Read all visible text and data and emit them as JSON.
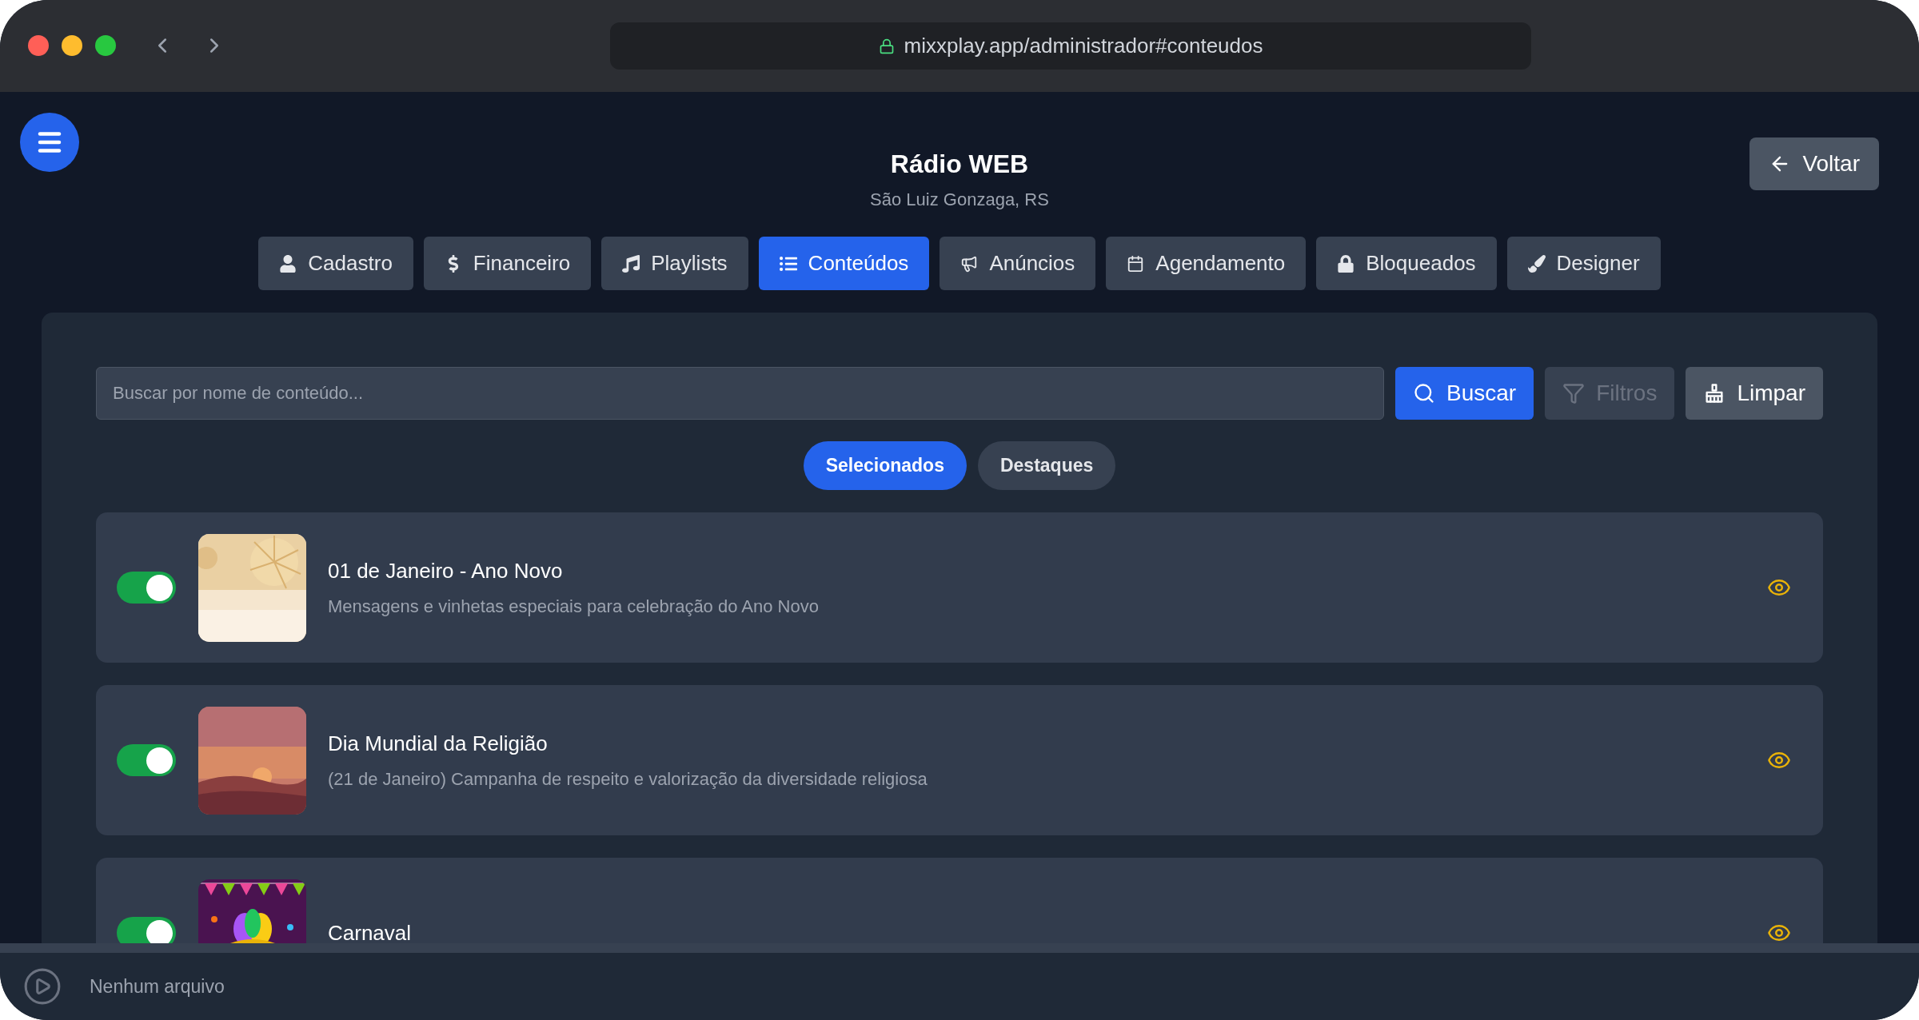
{
  "browser": {
    "url": "mixxplay.app/administrador#conteudos"
  },
  "header": {
    "title": "Rádio WEB",
    "subtitle": "São Luiz Gonzaga, RS",
    "back_button": "Voltar"
  },
  "tabs": [
    {
      "label": "Cadastro",
      "selected": false
    },
    {
      "label": "Financeiro",
      "selected": false
    },
    {
      "label": "Playlists",
      "selected": false
    },
    {
      "label": "Conteúdos",
      "selected": true
    },
    {
      "label": "Anúncios",
      "selected": false
    },
    {
      "label": "Agendamento",
      "selected": false
    },
    {
      "label": "Bloqueados",
      "selected": false
    },
    {
      "label": "Designer",
      "selected": false
    }
  ],
  "search": {
    "placeholder": "Buscar por nome de conteúdo...",
    "buttons": [
      {
        "label": "Buscar",
        "kind": "search",
        "disabled": false
      },
      {
        "label": "Filtros",
        "kind": "filter",
        "disabled": true
      },
      {
        "label": "Limpar",
        "kind": "clear",
        "disabled": false
      }
    ]
  },
  "filter_pills": [
    {
      "label": "Selecionados",
      "selected": true
    },
    {
      "label": "Destaques",
      "selected": false
    }
  ],
  "items": [
    {
      "title": "01 de Janeiro - Ano Novo",
      "description": "Mensagens e vinhetas especiais para celebração do Ano Novo",
      "on": true
    },
    {
      "title": "Dia Mundial da Religião",
      "description": "(21 de Janeiro) Campanha de respeito e valorização da diversidade religiosa",
      "on": true
    },
    {
      "title": "Carnaval",
      "on": true
    }
  ],
  "player": {
    "status": "Nenhum arquivo"
  }
}
